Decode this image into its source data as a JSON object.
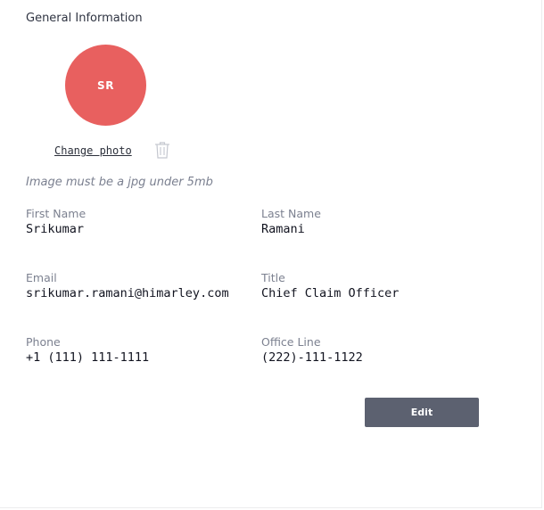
{
  "section": {
    "title": "General Information"
  },
  "avatar": {
    "initials": "SR",
    "color": "#e8605f"
  },
  "photo": {
    "change_label": "Change photo",
    "delete_icon": "trash-icon",
    "hint": "Image must be a jpg under 5mb"
  },
  "fields": {
    "first_name": {
      "label": "First Name",
      "value": "Srikumar"
    },
    "last_name": {
      "label": "Last Name",
      "value": "Ramani"
    },
    "email": {
      "label": "Email",
      "value": "srikumar.ramani@himarley.com"
    },
    "title": {
      "label": "Title",
      "value": "Chief Claim Officer"
    },
    "phone": {
      "label": "Phone",
      "value": "+1 (111) 111-1111"
    },
    "office_line": {
      "label": "Office Line",
      "value": "(222)-111-1122"
    }
  },
  "actions": {
    "edit_label": "Edit",
    "edit_color": "#5c6170"
  }
}
